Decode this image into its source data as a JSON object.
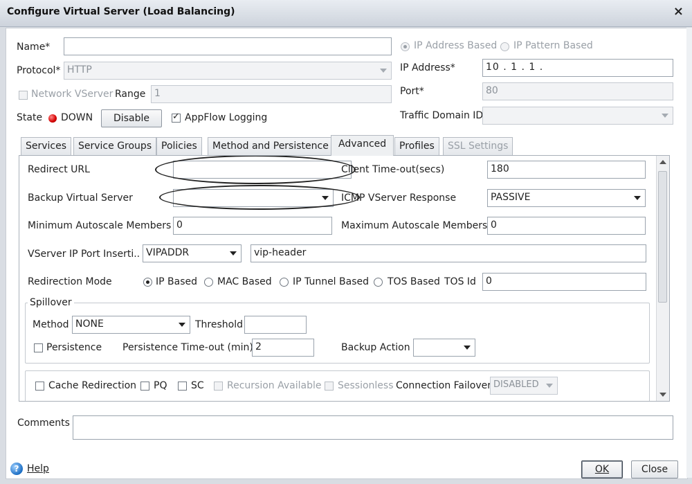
{
  "window": {
    "title": "Configure Virtual Server (Load Balancing)",
    "close_glyph": "×"
  },
  "general": {
    "name_label": "Name*",
    "name_value": "",
    "protocol_label": "Protocol*",
    "protocol_value": "HTTP",
    "network_vserver_label": "Network VServer",
    "range_label": "Range",
    "range_value": "1",
    "state_label": "State",
    "state_value": "DOWN",
    "disable_button": "Disable",
    "appflow_label": "AppFlow Logging",
    "appflow_checked": true,
    "ip_address_based_label": "IP Address Based",
    "ip_pattern_based_label": "IP Pattern Based",
    "ip_address_label": "IP Address*",
    "ip_address_value": "10 . 1 . 1 .",
    "port_label": "Port*",
    "port_value": "80",
    "traffic_domain_label": "Traffic Domain ID",
    "traffic_domain_value": ""
  },
  "tabs": [
    {
      "label": "Services",
      "active": false,
      "disabled": false
    },
    {
      "label": "Service Groups",
      "active": false,
      "disabled": false
    },
    {
      "label": "Policies",
      "active": false,
      "disabled": false
    },
    {
      "label": "Method and Persistence",
      "active": false,
      "disabled": false
    },
    {
      "label": "Advanced",
      "active": true,
      "disabled": false
    },
    {
      "label": "Profiles",
      "active": false,
      "disabled": false
    },
    {
      "label": "SSL Settings",
      "active": false,
      "disabled": true
    }
  ],
  "advanced": {
    "redirect_url_label": "Redirect URL",
    "redirect_url_value": "",
    "client_timeout_label": "Client Time-out(secs)",
    "client_timeout_value": "180",
    "backup_vserver_label": "Backup Virtual Server",
    "backup_vserver_value": "",
    "icmp_label": "ICMP VServer Response",
    "icmp_value": "PASSIVE",
    "min_autoscale_label": "Minimum Autoscale Members",
    "min_autoscale_value": "0",
    "max_autoscale_label": "Maximum Autoscale Members",
    "max_autoscale_value": "0",
    "vserver_ip_port_label": "VServer IP Port Inserti...",
    "vserver_ip_port_value": "VIPADDR",
    "vip_header_value": "vip-header",
    "redirection_mode_label": "Redirection Mode",
    "modes": [
      "IP Based",
      "MAC Based",
      "IP Tunnel Based",
      "TOS Based"
    ],
    "selected_mode": "IP Based",
    "tos_id_label": "TOS Id",
    "tos_id_value": "0",
    "spillover": {
      "legend": "Spillover",
      "method_label": "Method",
      "method_value": "NONE",
      "threshold_label": "Threshold",
      "threshold_value": "",
      "persistence_label": "Persistence",
      "persistence_timeout_label": "Persistence Time-out (min)",
      "persistence_timeout_value": "2",
      "backup_action_label": "Backup Action",
      "backup_action_value": ""
    },
    "cache_redirection_label": "Cache Redirection",
    "pq_label": "PQ",
    "sc_label": "SC",
    "recursion_label": "Recursion Available",
    "sessionless_label": "Sessionless",
    "connection_failover_label": "Connection Failover",
    "connection_failover_value": "DISABLED"
  },
  "footer": {
    "comments_label": "Comments",
    "comments_value": "",
    "help_label": "Help",
    "ok_label": "OK",
    "close_label": "Close"
  },
  "colors": {
    "state_down": "#d40000",
    "help_icon": "#1d6fc4"
  }
}
